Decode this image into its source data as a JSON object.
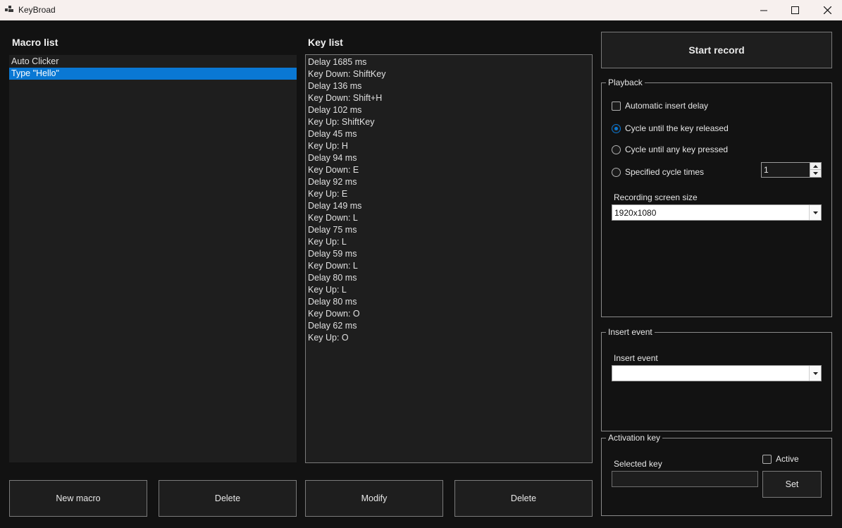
{
  "window": {
    "title": "KeyBroad"
  },
  "macro_list": {
    "label": "Macro list",
    "items": [
      {
        "label": "Auto Clicker",
        "selected": false
      },
      {
        "label": "Type \"Hello\"",
        "selected": true
      }
    ],
    "new_button": "New macro",
    "delete_button": "Delete"
  },
  "key_list": {
    "label": "Key list",
    "items": [
      "Delay 1685 ms",
      "Key Down: ShiftKey",
      "Delay 136 ms",
      "Key Down: Shift+H",
      "Delay 102 ms",
      "Key Up: ShiftKey",
      "Delay 45 ms",
      "Key Up: H",
      "Delay 94 ms",
      "Key Down: E",
      "Delay 92 ms",
      "Key Up: E",
      "Delay 149 ms",
      "Key Down: L",
      "Delay 75 ms",
      "Key Up: L",
      "Delay 59 ms",
      "Key Down: L",
      "Delay 80 ms",
      "Key Up: L",
      "Delay 80 ms",
      "Key Down: O",
      "Delay 62 ms",
      "Key Up: O"
    ],
    "modify_button": "Modify",
    "delete_button": "Delete"
  },
  "record": {
    "button": "Start record"
  },
  "playback": {
    "legend": "Playback",
    "auto_insert_delay": {
      "label": "Automatic insert delay",
      "checked": false
    },
    "mode_options": [
      {
        "label": "Cycle until the key released",
        "selected": true
      },
      {
        "label": "Cycle until any key pressed",
        "selected": false
      },
      {
        "label": "Specified cycle times",
        "selected": false
      }
    ],
    "cycle_times": "1",
    "screen_size_label": "Recording screen size",
    "screen_size_value": "1920x1080"
  },
  "insert_event": {
    "legend": "Insert event",
    "label": "Insert event",
    "value": ""
  },
  "activation_key": {
    "legend": "Activation key",
    "selected_key_label": "Selected key",
    "selected_key_value": "",
    "active_label": "Active",
    "active_checked": false,
    "set_button": "Set"
  },
  "colors": {
    "accent": "#0a78d4",
    "background": "#121212",
    "panel": "#1e1e1e"
  }
}
